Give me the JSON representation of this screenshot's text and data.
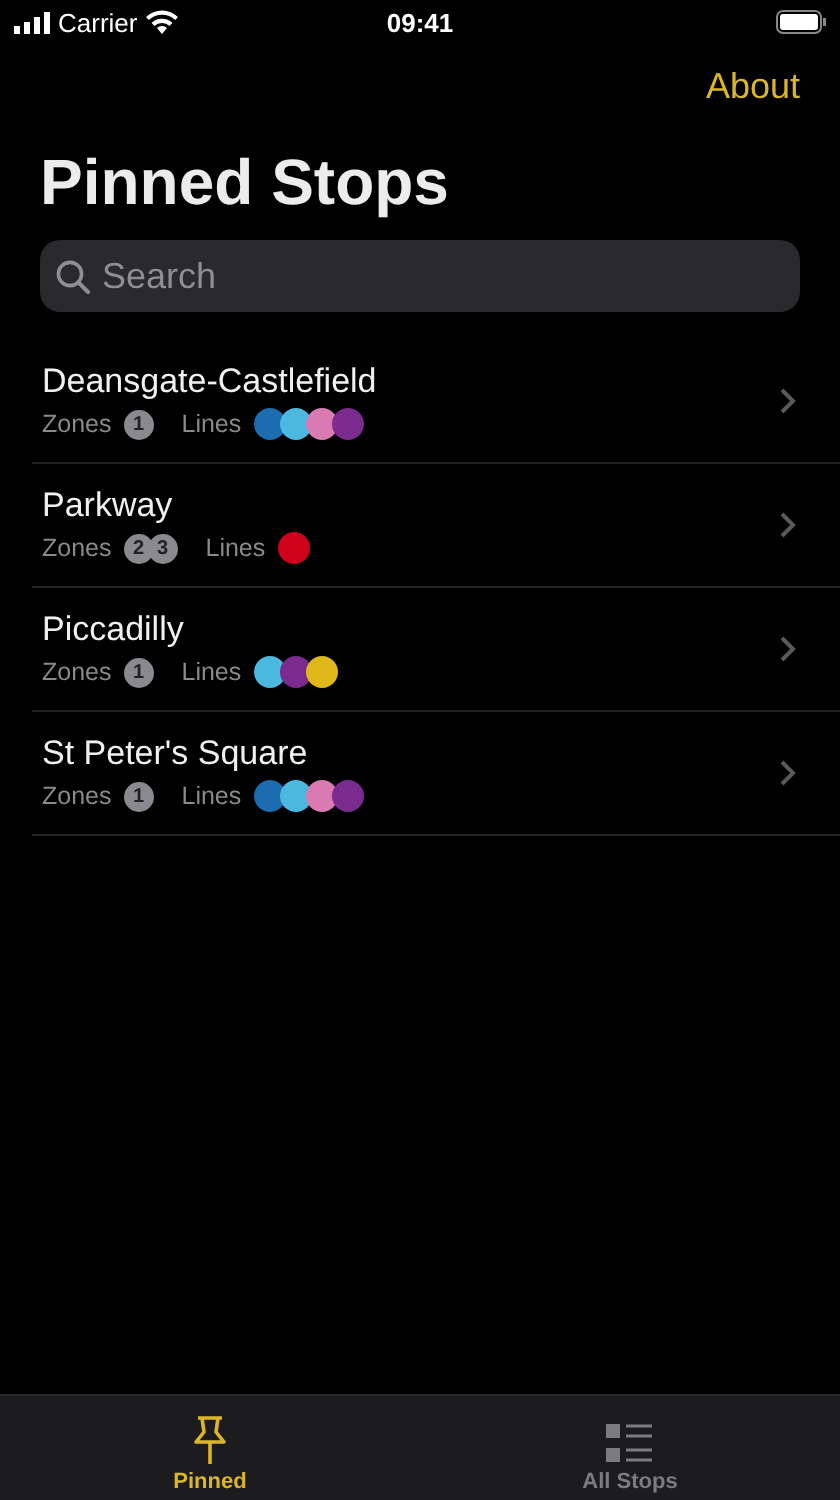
{
  "status_bar": {
    "carrier": "Carrier",
    "time": "09:41"
  },
  "nav": {
    "action": "About"
  },
  "title": "Pinned Stops",
  "search": {
    "placeholder": "Search"
  },
  "stops": [
    {
      "name": "Deansgate-Castlefield",
      "zones_label": "Zones",
      "zones": [
        "1"
      ],
      "lines_label": "Lines",
      "lines": [
        {
          "color": "#1b6db0"
        },
        {
          "color": "#4bb8e0"
        },
        {
          "color": "#d97bb2"
        },
        {
          "color": "#7b2b8e"
        }
      ]
    },
    {
      "name": "Parkway",
      "zones_label": "Zones",
      "zones": [
        "2",
        "3"
      ],
      "lines_label": "Lines",
      "lines": [
        {
          "color": "#d0021b"
        }
      ]
    },
    {
      "name": "Piccadilly",
      "zones_label": "Zones",
      "zones": [
        "1"
      ],
      "lines_label": "Lines",
      "lines": [
        {
          "color": "#4bb8e0"
        },
        {
          "color": "#7b2b8e"
        },
        {
          "color": "#dfb718"
        }
      ]
    },
    {
      "name": "St Peter's Square",
      "zones_label": "Zones",
      "zones": [
        "1"
      ],
      "lines_label": "Lines",
      "lines": [
        {
          "color": "#1b6db0"
        },
        {
          "color": "#4bb8e0"
        },
        {
          "color": "#d97bb2"
        },
        {
          "color": "#7b2b8e"
        }
      ]
    }
  ],
  "tabs": [
    {
      "kind": "pinned",
      "label": "Pinned",
      "selected": true
    },
    {
      "kind": "list",
      "label": "All Stops",
      "selected": false
    }
  ]
}
